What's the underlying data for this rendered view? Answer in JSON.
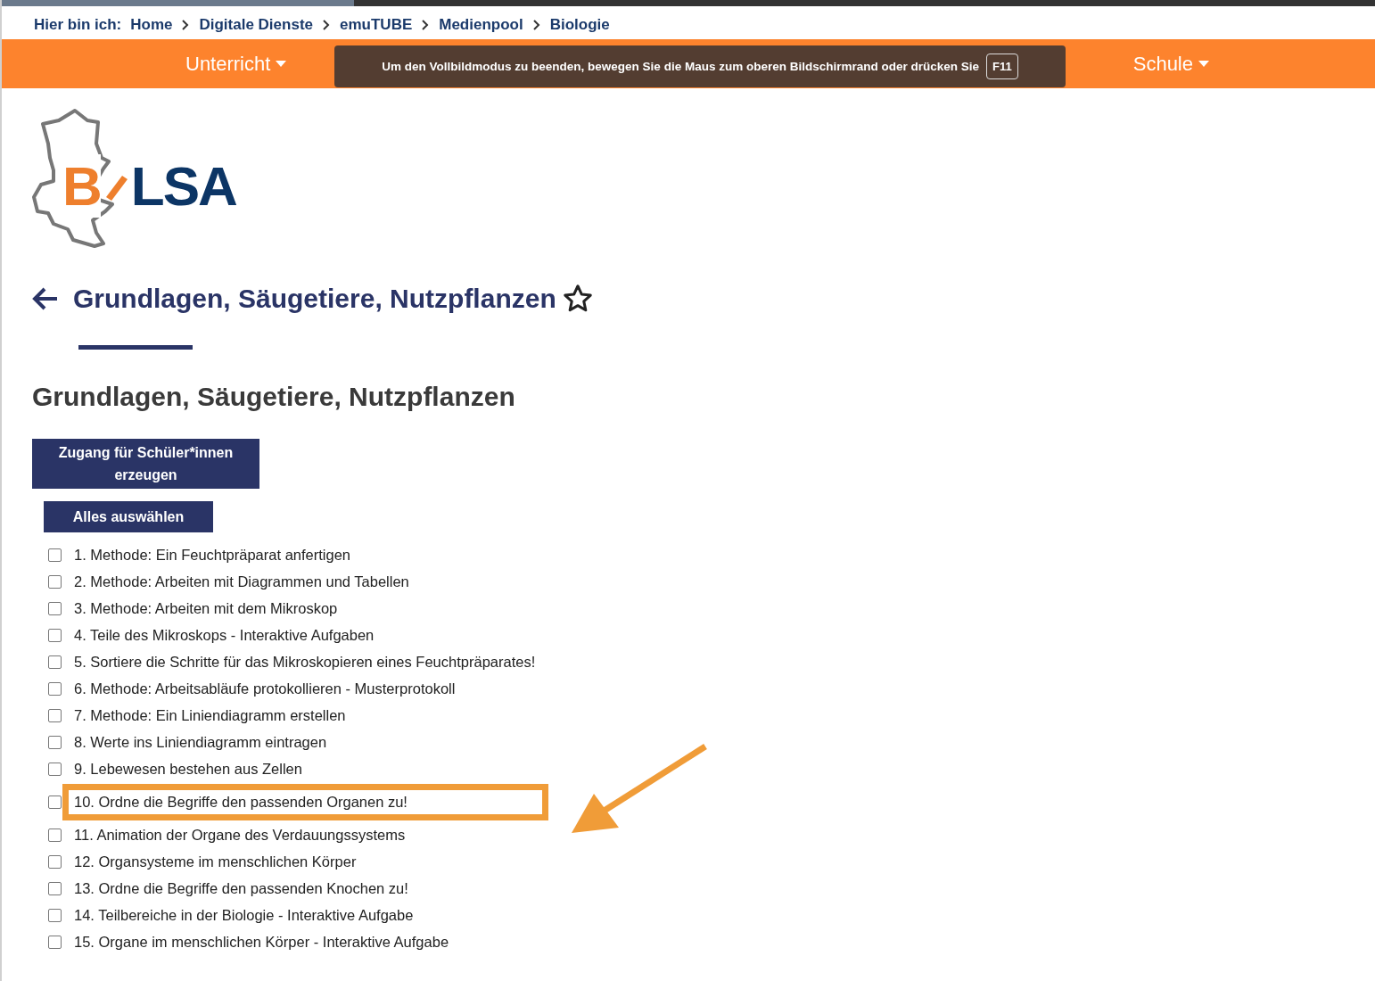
{
  "breadcrumb": {
    "label": "Hier bin ich:",
    "items": [
      "Home",
      "Digitale Dienste",
      "emuTUBE",
      "Medienpool",
      "Biologie"
    ]
  },
  "nav": {
    "items": [
      {
        "label": "Unterricht"
      },
      {
        "label": "Schule"
      }
    ]
  },
  "fullscreen_notice": {
    "text": "Um den Vollbildmodus zu beenden, bewegen Sie die Maus zum oberen Bildschirmrand oder drücken Sie",
    "key": "F11"
  },
  "logo": {
    "first": "B",
    "rest": "LSA"
  },
  "page_title": "Grundlagen, Säugetiere, Nutzpflanzen",
  "section_title": "Grundlagen, Säugetiere, Nutzpflanzen",
  "buttons": {
    "access": "Zugang für Schüler*innen erzeugen",
    "select_all": "Alles auswählen"
  },
  "items": [
    {
      "label": "1. Methode: Ein Feuchtpräparat anfertigen",
      "checked": false,
      "highlighted": false
    },
    {
      "label": "2. Methode: Arbeiten mit Diagrammen und Tabellen",
      "checked": false,
      "highlighted": false
    },
    {
      "label": "3. Methode: Arbeiten mit dem Mikroskop",
      "checked": false,
      "highlighted": false
    },
    {
      "label": "4. Teile des Mikroskops - Interaktive Aufgaben",
      "checked": false,
      "highlighted": false
    },
    {
      "label": "5. Sortiere die Schritte für das Mikroskopieren eines Feuchtpräparates!",
      "checked": false,
      "highlighted": false
    },
    {
      "label": "6. Methode: Arbeitsabläufe protokollieren - Musterprotokoll",
      "checked": false,
      "highlighted": false
    },
    {
      "label": "7. Methode: Ein Liniendiagramm erstellen",
      "checked": false,
      "highlighted": false
    },
    {
      "label": "8. Werte ins Liniendiagramm eintragen",
      "checked": false,
      "highlighted": false
    },
    {
      "label": "9. Lebewesen bestehen aus Zellen",
      "checked": false,
      "highlighted": false
    },
    {
      "label": "10. Ordne die Begriffe den passenden Organen zu!",
      "checked": false,
      "highlighted": true
    },
    {
      "label": "11. Animation der Organe des Verdauungssystems",
      "checked": false,
      "highlighted": false
    },
    {
      "label": "12. Organsysteme im menschlichen Körper",
      "checked": false,
      "highlighted": false
    },
    {
      "label": "13. Ordne die Begriffe den passenden Knochen zu!",
      "checked": false,
      "highlighted": false
    },
    {
      "label": "14. Teilbereiche in der Biologie - Interaktive Aufgabe",
      "checked": false,
      "highlighted": false
    },
    {
      "label": "15. Organe im menschlichen Körper - Interaktive Aufgabe",
      "checked": false,
      "highlighted": false
    }
  ]
}
